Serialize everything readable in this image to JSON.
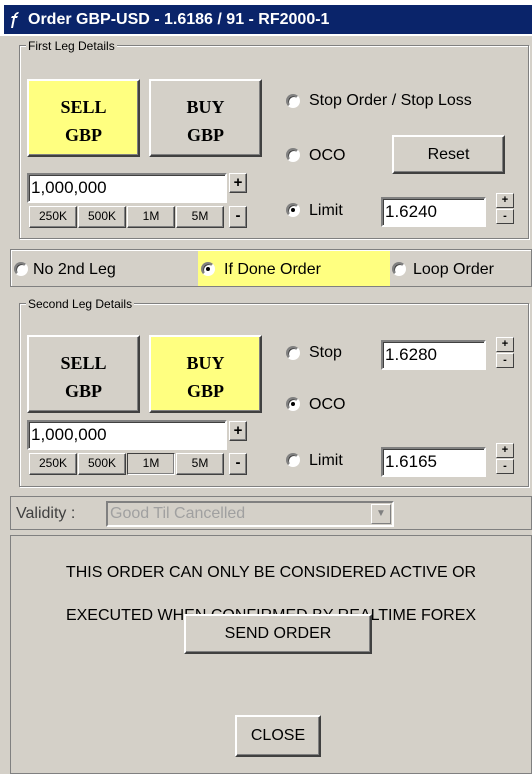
{
  "window": {
    "title": "Order GBP-USD - 1.6186 / 91 - RF2000-1"
  },
  "first_leg": {
    "group_title": "First Leg Details",
    "sell_label_1": "SELL",
    "sell_label_2": "GBP",
    "buy_label_1": "BUY",
    "buy_label_2": "GBP",
    "amount": "1,000,000",
    "plus": "+",
    "minus": "-",
    "quick_amounts": [
      "250K",
      "500K",
      "1M",
      "5M"
    ],
    "stop_label": "Stop Order / Stop Loss",
    "oco_label": "OCO",
    "reset_label": "Reset",
    "limit_label": "Limit",
    "limit_value": "1.6240",
    "selected_side": "SELL",
    "selected_type": "Limit"
  },
  "leg_mode": {
    "options": [
      "No 2nd Leg",
      "If Done Order",
      "Loop Order"
    ],
    "selected": "If Done Order",
    "highlight_color": "#ffff80"
  },
  "second_leg": {
    "group_title": "Second Leg Details",
    "sell_label_1": "SELL",
    "sell_label_2": "GBP",
    "buy_label_1": "BUY",
    "buy_label_2": "GBP",
    "amount": "1,000,000",
    "plus": "+",
    "minus": "-",
    "quick_amounts": [
      "250K",
      "500K",
      "1M",
      "5M"
    ],
    "stop_label": "Stop",
    "stop_value": "1.6280",
    "oco_label": "OCO",
    "limit_label": "Limit",
    "limit_value": "1.6165",
    "selected_side": "BUY",
    "selected_type": "OCO"
  },
  "validity": {
    "label": "Validity :",
    "value": "Good Til Cancelled"
  },
  "notice": {
    "line1": "THIS ORDER CAN ONLY BE CONSIDERED ACTIVE OR",
    "line2": "EXECUTED WHEN CONFIRMED BY REALTIME FOREX"
  },
  "actions": {
    "send_label": "SEND ORDER",
    "close_label": "CLOSE"
  },
  "spin": {
    "up": "+",
    "down": "-"
  },
  "colors": {
    "title_bg": "#0a246a",
    "window_bg": "#d4d0c8",
    "active_button": "#ffff80"
  }
}
